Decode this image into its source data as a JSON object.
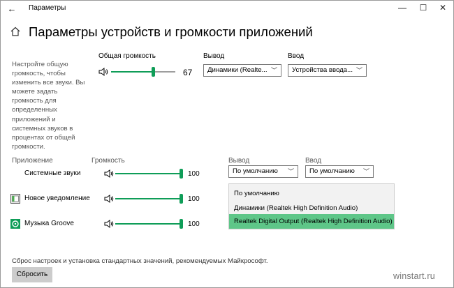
{
  "window": {
    "title": "Параметры",
    "back_glyph": "←",
    "minimize_glyph": "—",
    "maximize_glyph": "☐",
    "close_glyph": "✕"
  },
  "page": {
    "title": "Параметры устройств и громкости приложений",
    "description": "Настройте общую громкость, чтобы изменить все звуки. Вы можете задать громкость для определенных приложений и системных звуков в процентах от общей громкости."
  },
  "master": {
    "label": "Общая громкость",
    "value": "67",
    "level": 0.67,
    "output_label": "Вывод",
    "output_value": "Динамики (Realte...",
    "input_label": "Ввод",
    "input_value": "Устройства ввода..."
  },
  "apps_header": {
    "app": "Приложение",
    "volume": "Громкость",
    "output": "Вывод",
    "input": "Ввод"
  },
  "apps": [
    {
      "name": "Системные звуки",
      "value": "100",
      "level": 1.0,
      "output": "По умолчанию",
      "input": "По умолчанию"
    },
    {
      "name": "Новое уведомление",
      "value": "100",
      "level": 1.0
    },
    {
      "name": "Музыка Groove",
      "value": "100",
      "level": 1.0
    }
  ],
  "output_menu": {
    "options": [
      "По умолчанию",
      "Динамики (Realtek High Definition Audio)",
      "Realtek Digital Output (Realtek High Definition Audio)"
    ],
    "selected_index": 2
  },
  "reset": {
    "text": "Сброс настроек и установка стандартных значений, рекомендуемых Майкрософт.",
    "button": "Сбросить"
  },
  "watermark": "winstart.ru",
  "colors": {
    "accent": "#0f9d58",
    "menu_highlight": "#5ec688"
  }
}
